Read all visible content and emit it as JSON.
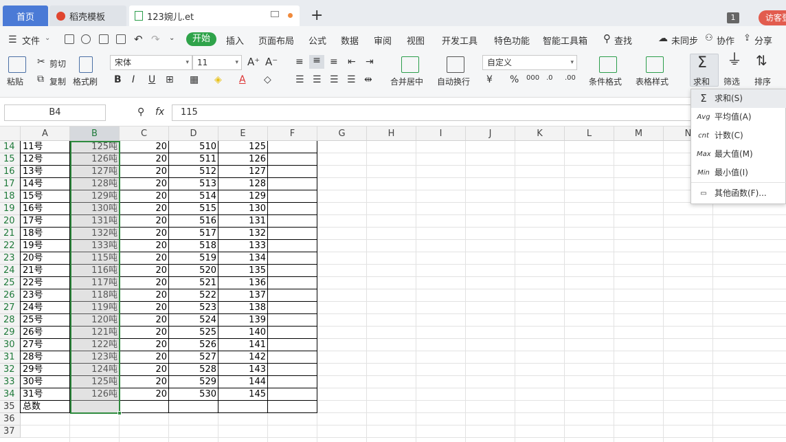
{
  "tabs": {
    "home": "首页",
    "template": "稻壳模板",
    "file": "123婉儿.et",
    "new_tab": "+",
    "count": "1",
    "guest": "访客登"
  },
  "menu": {
    "file": "文件",
    "start": "开始",
    "items": [
      "插入",
      "页面布局",
      "公式",
      "数据",
      "审阅",
      "视图",
      "开发工具",
      "特色功能",
      "智能工具箱"
    ],
    "search": "查找",
    "sync": "未同步",
    "collab": "协作",
    "share": "分享"
  },
  "ribbon": {
    "paste": "粘贴",
    "cut": "剪切",
    "copy": "复制",
    "format_painter": "格式刷",
    "font_name": "宋体",
    "font_size": "11",
    "merge": "合并居中",
    "wrap": "自动换行",
    "number_format": "自定义",
    "cond_format": "条件格式",
    "table_style": "表格样式",
    "sum": "求和",
    "filter": "筛选",
    "sort": "排序",
    "bold": "B",
    "italic": "I",
    "underline": "U",
    "percent": "%",
    "thousands": "000"
  },
  "formula_bar": {
    "name_box": "B4",
    "fx": "fx",
    "formula": "115"
  },
  "columns": [
    "A",
    "B",
    "C",
    "D",
    "E",
    "F",
    "G",
    "H",
    "I",
    "J",
    "K",
    "L",
    "M",
    "N"
  ],
  "rows": [
    {
      "n": "14",
      "a": "11号",
      "b": "125吨",
      "c": "20",
      "d": "510",
      "e": "125"
    },
    {
      "n": "15",
      "a": "12号",
      "b": "126吨",
      "c": "20",
      "d": "511",
      "e": "126"
    },
    {
      "n": "16",
      "a": "13号",
      "b": "127吨",
      "c": "20",
      "d": "512",
      "e": "127"
    },
    {
      "n": "17",
      "a": "14号",
      "b": "128吨",
      "c": "20",
      "d": "513",
      "e": "128"
    },
    {
      "n": "18",
      "a": "15号",
      "b": "129吨",
      "c": "20",
      "d": "514",
      "e": "129"
    },
    {
      "n": "19",
      "a": "16号",
      "b": "130吨",
      "c": "20",
      "d": "515",
      "e": "130"
    },
    {
      "n": "20",
      "a": "17号",
      "b": "131吨",
      "c": "20",
      "d": "516",
      "e": "131"
    },
    {
      "n": "21",
      "a": "18号",
      "b": "132吨",
      "c": "20",
      "d": "517",
      "e": "132"
    },
    {
      "n": "22",
      "a": "19号",
      "b": "133吨",
      "c": "20",
      "d": "518",
      "e": "133"
    },
    {
      "n": "23",
      "a": "20号",
      "b": "115吨",
      "c": "20",
      "d": "519",
      "e": "134"
    },
    {
      "n": "24",
      "a": "21号",
      "b": "116吨",
      "c": "20",
      "d": "520",
      "e": "135"
    },
    {
      "n": "25",
      "a": "22号",
      "b": "117吨",
      "c": "20",
      "d": "521",
      "e": "136"
    },
    {
      "n": "26",
      "a": "23号",
      "b": "118吨",
      "c": "20",
      "d": "522",
      "e": "137"
    },
    {
      "n": "27",
      "a": "24号",
      "b": "119吨",
      "c": "20",
      "d": "523",
      "e": "138"
    },
    {
      "n": "28",
      "a": "25号",
      "b": "120吨",
      "c": "20",
      "d": "524",
      "e": "139"
    },
    {
      "n": "29",
      "a": "26号",
      "b": "121吨",
      "c": "20",
      "d": "525",
      "e": "140"
    },
    {
      "n": "30",
      "a": "27号",
      "b": "122吨",
      "c": "20",
      "d": "526",
      "e": "141"
    },
    {
      "n": "31",
      "a": "28号",
      "b": "123吨",
      "c": "20",
      "d": "527",
      "e": "142"
    },
    {
      "n": "32",
      "a": "29号",
      "b": "124吨",
      "c": "20",
      "d": "528",
      "e": "143"
    },
    {
      "n": "33",
      "a": "30号",
      "b": "125吨",
      "c": "20",
      "d": "529",
      "e": "144"
    },
    {
      "n": "34",
      "a": "31号",
      "b": "126吨",
      "c": "20",
      "d": "530",
      "e": "145"
    },
    {
      "n": "35",
      "a": "总数",
      "b": "",
      "c": "",
      "d": "",
      "e": ""
    },
    {
      "n": "36",
      "a": "",
      "b": "",
      "c": "",
      "d": "",
      "e": ""
    },
    {
      "n": "37",
      "a": "",
      "b": "",
      "c": "",
      "d": "",
      "e": ""
    }
  ],
  "sum_menu": [
    {
      "icon": "Σ",
      "label": "求和(S)"
    },
    {
      "icon": "Avg",
      "label": "平均值(A)"
    },
    {
      "icon": "cnt",
      "label": "计数(C)"
    },
    {
      "icon": "Max",
      "label": "最大值(M)"
    },
    {
      "icon": "Min",
      "label": "最小值(I)"
    },
    {
      "icon": "▭",
      "label": "其他函数(F)..."
    }
  ]
}
